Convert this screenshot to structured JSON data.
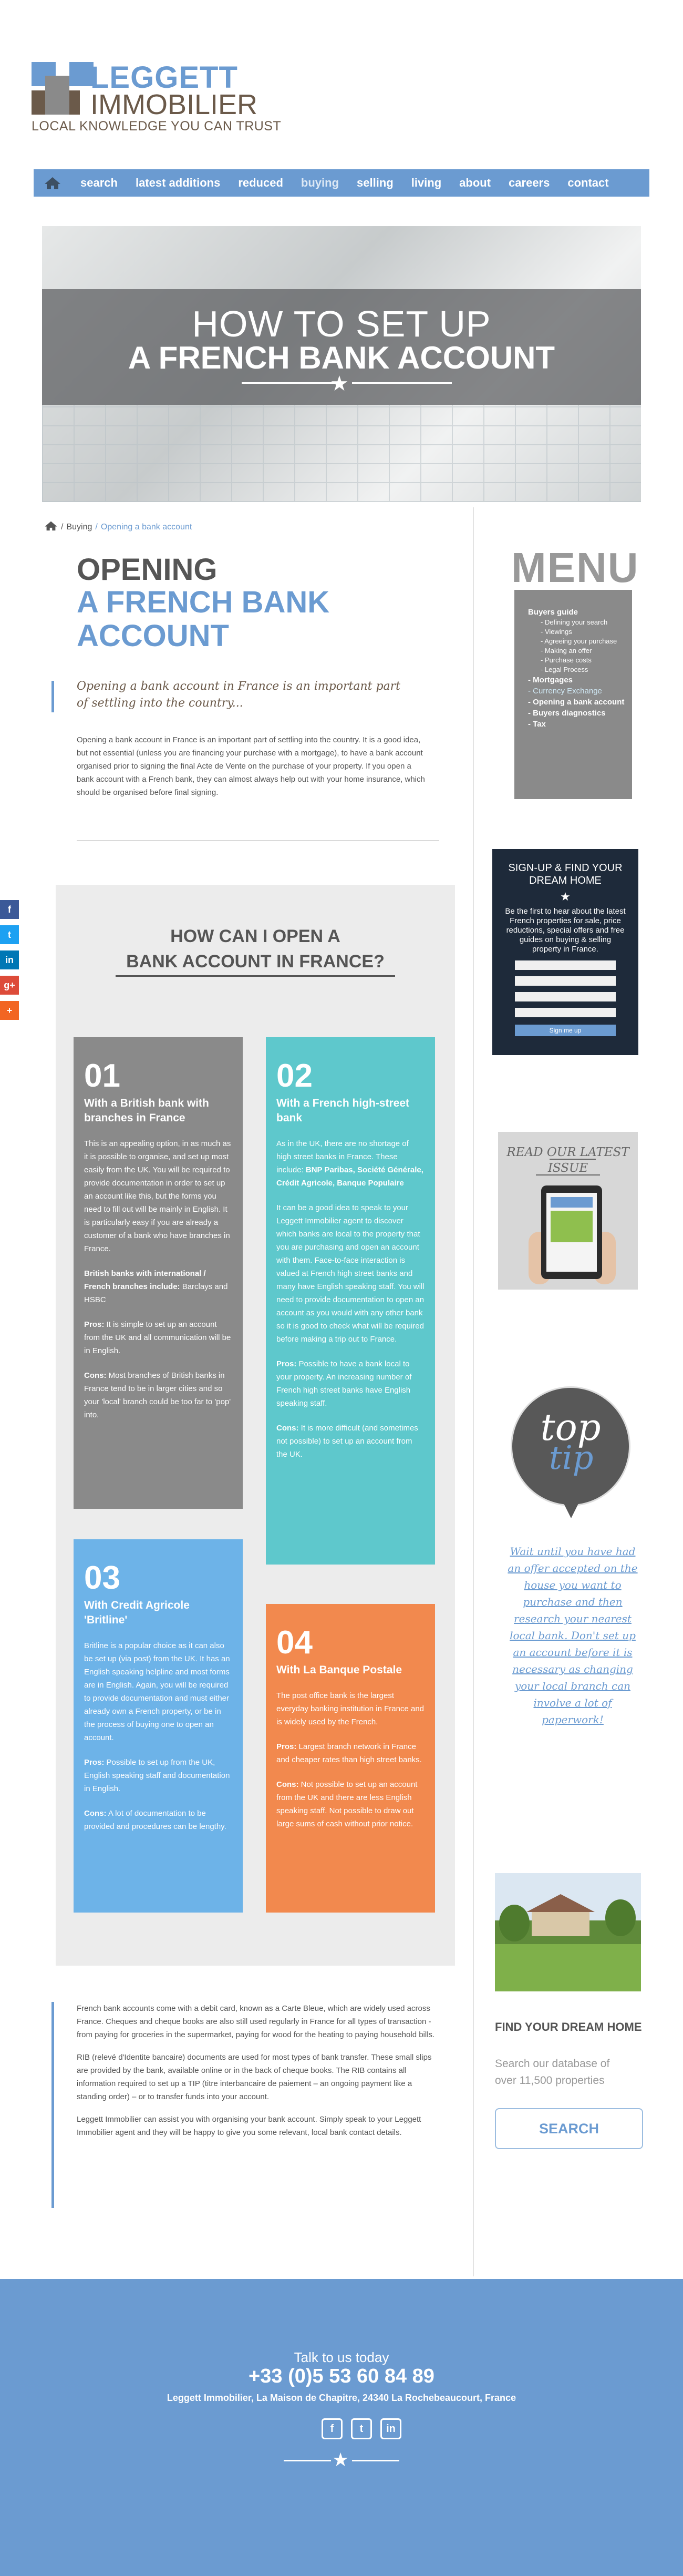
{
  "brand": {
    "name": "LEGGETT",
    "sub": "IMMOBILIER",
    "tagline": "LOCAL KNOWLEDGE YOU CAN TRUST",
    "colors": {
      "blue": "#6b9bd1",
      "brown": "#6b5a4a",
      "grey": "#8a8a8a"
    }
  },
  "nav": {
    "home_icon": "home-icon",
    "items": [
      "search",
      "latest additions",
      "reduced",
      "buying",
      "selling",
      "living",
      "about",
      "careers",
      "contact"
    ]
  },
  "hero": {
    "line1": "HOW TO SET UP",
    "line2": "A FRENCH BANK ACCOUNT"
  },
  "breadcrumb": {
    "sep": "/",
    "parent": "Buying",
    "current": "Opening a bank account"
  },
  "article": {
    "title1": "OPENING",
    "title2": "A FRENCH BANK ACCOUNT",
    "lead": "Opening a bank account in France is an important part of settling into the country...",
    "intro": "Opening a bank account in France is an important part of settling into the country.  It is a good idea, but not essential (unless you are financing your purchase with a mortgage), to have a bank account organised prior to signing the final Acte de Vente on the purchase of your property.  If you open a bank account with a French bank, they can almost always help out with your home insurance, which should be organised before final signing.",
    "question1": "HOW CAN I OPEN A",
    "question2": "BANK ACCOUNT IN FRANCE?",
    "boxes": [
      {
        "num": "01",
        "title": "With a British bank with branches in France",
        "p1": "This is an appealing option, in as much as it is possible to organise, and set up most easily from the UK.  You will be required to provide documentation in order to set up an account like this, but the forms you need to fill out will be mainly in English.  It is particularly easy if you are already a customer of a bank who have branches in France.",
        "p2_label": "British banks with international / French branches include:",
        "p2": " Barclays and HSBC",
        "pros_label": "Pros:",
        "pros": " It is simple to set up an account from the UK and all communication will be in English.",
        "cons_label": "Cons:",
        "cons": " Most branches of British banks in France tend to be in larger cities and so your 'local' branch could be too far to 'pop' into."
      },
      {
        "num": "02",
        "title": "With a French high-street bank",
        "p1": "As in the UK, there are no shortage of high street banks in France.  These include: ",
        "p1_bold": "BNP Paribas, Société Générale, Crédit Agricole, Banque Populaire",
        "p2": " It can be a good idea to speak to your Leggett Immobilier agent to discover which banks are local to the property that you are purchasing and open an account with them.  Face-to-face interaction is valued at French high street banks and many have English speaking staff.  You will need to provide documentation to open an account as you would with any other bank so it is good to check what will be required before making a trip out to France.",
        "pros_label": "Pros:",
        "pros": "  Possible to have a bank local to your property.  An increasing number of French high street banks have English speaking staff.",
        "cons_label": "Cons:",
        "cons": "  It is more difficult (and sometimes not possible) to set up an account from the UK."
      },
      {
        "num": "03",
        "title": "With Credit Agricole 'Britline'",
        "p1": "Britline is a popular choice as it can also be set up (via post) from the UK. It has an English speaking helpline and most forms are in English.  Again, you will be required to provide documentation and must either already own a French property, or be in the process of buying one to open an account.",
        "pros_label": "Pros:",
        "pros": " Possible to set up from the UK, English speaking staff and documentation in English.",
        "cons_label": "Cons:",
        "cons": " A lot of documentation to be provided and procedures can be lengthy."
      },
      {
        "num": "04",
        "title": "With La Banque Postale",
        "p1": "The post office bank is the largest everyday banking institution in France and is widely used by the French.",
        "pros_label": "Pros:",
        "pros": "  Largest branch network in France and cheaper rates than high street banks.",
        "cons_label": "Cons:",
        "cons": "  Not possible to set up an account from the UK and there are less English speaking staff.  Not possible to draw out large sums of cash without prior notice."
      }
    ],
    "outro": [
      "French bank accounts come with a debit card, known as a Carte Bleue, which are widely used across France.  Cheques and cheque books are also still used regularly in France for all types of transaction - from paying for groceries in the supermarket, paying for wood for the heating to paying household bills.",
      "RIB (relevé d'Identite bancaire) documents are used for most types of bank transfer.  These small slips are provided by the bank, available online or in the back of cheque books.  The RIB contains all information required to set up a TIP (titre interbancaire de paiement – an ongoing payment like a standing order) – or to transfer funds into your account.",
      "Leggett Immobilier can assist you with organising your bank account.  Simply speak to your Leggett Immobilier agent and they will be happy to give you some relevant, local bank contact details."
    ]
  },
  "sidebar": {
    "menu_title": "MENU",
    "menu_items": [
      {
        "label": "Buyers guide",
        "level": "top"
      },
      {
        "label": "- Defining your search",
        "level": "sub"
      },
      {
        "label": "- Viewings",
        "level": "sub"
      },
      {
        "label": "- Agreeing your purchase",
        "level": "sub"
      },
      {
        "label": "- Making an offer",
        "level": "sub"
      },
      {
        "label": "- Purchase costs",
        "level": "sub"
      },
      {
        "label": "- Legal Process",
        "level": "sub"
      },
      {
        "label": "- Mortgages",
        "level": "top"
      },
      {
        "label": "- Currency Exchange",
        "level": "hl"
      },
      {
        "label": "- Opening a bank account",
        "level": "top"
      },
      {
        "label": "- Buyers diagnostics",
        "level": "top"
      },
      {
        "label": "- Tax",
        "level": "top"
      }
    ],
    "signup": {
      "title": "SIGN-UP & FIND YOUR DREAM HOME",
      "desc": "Be the first to hear about the latest French properties for sale, price reductions, special offers and free guides on buying & selling property in France.",
      "button": "Sign me up"
    },
    "issue_link": "READ OUR LATEST ISSUE",
    "tip_word1": "top",
    "tip_word2": "tip",
    "tip_text": "Wait until you have had an offer accepted on the house you want to purchase and then research your nearest local bank. Don't set up an account before it is necessary as changing your local branch can involve a lot of paperwork!",
    "find_title": "FIND YOUR DREAM HOME",
    "find_desc": "Search our database of over 11,500 properties",
    "search_button": "SEARCH"
  },
  "social": [
    {
      "icon": "facebook-icon",
      "glyph": "f",
      "color": "#3b5998"
    },
    {
      "icon": "twitter-icon",
      "glyph": "t",
      "color": "#1da1f2"
    },
    {
      "icon": "linkedin-icon",
      "glyph": "in",
      "color": "#0077b5"
    },
    {
      "icon": "googleplus-icon",
      "glyph": "g+",
      "color": "#dd4b39"
    },
    {
      "icon": "more-icon",
      "glyph": "+",
      "color": "#f26522"
    }
  ],
  "footer": {
    "talk": "Talk to us today",
    "phone": "+33 (0)5 53 60 84 89",
    "address": "Leggett Immobilier, La Maison de Chapitre, 24340 La Rochebeaucourt, France",
    "icons": [
      {
        "icon": "facebook-icon",
        "glyph": "f"
      },
      {
        "icon": "twitter-icon",
        "glyph": "t"
      },
      {
        "icon": "linkedin-icon",
        "glyph": "in"
      }
    ]
  }
}
